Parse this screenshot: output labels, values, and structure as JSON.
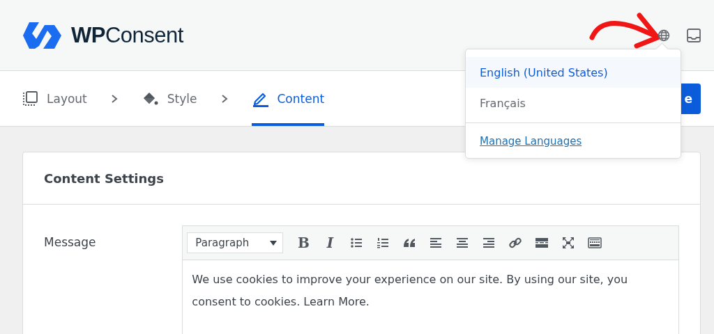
{
  "brand": {
    "name_bold": "WP",
    "name_rest": "Consent"
  },
  "steps": [
    {
      "label": "Layout",
      "kind": "layout",
      "selected": false
    },
    {
      "label": "Style",
      "kind": "style",
      "selected": false
    },
    {
      "label": "Content",
      "kind": "content",
      "selected": true
    }
  ],
  "primary_button": {
    "label": "e"
  },
  "language_menu": {
    "items": [
      {
        "label": "English (United States)",
        "selected": true
      },
      {
        "label": "Français",
        "selected": false
      }
    ],
    "link": "Manage Languages"
  },
  "card": {
    "title": "Content Settings",
    "field": {
      "label": "Message",
      "editor": {
        "format": "Paragraph",
        "toolbar": [
          {
            "kind": "bold",
            "label": "B"
          },
          {
            "kind": "italic",
            "label": "I"
          },
          {
            "kind": "bullet-list"
          },
          {
            "kind": "numbered-list"
          },
          {
            "kind": "quote"
          },
          {
            "kind": "align-left"
          },
          {
            "kind": "align-center"
          },
          {
            "kind": "align-right"
          },
          {
            "kind": "link"
          },
          {
            "kind": "read-more"
          },
          {
            "kind": "fullscreen"
          },
          {
            "kind": "keyboard"
          }
        ],
        "text": "We use cookies to improve your experience on our site. By using our site, you consent to cookies. Learn More."
      }
    }
  }
}
